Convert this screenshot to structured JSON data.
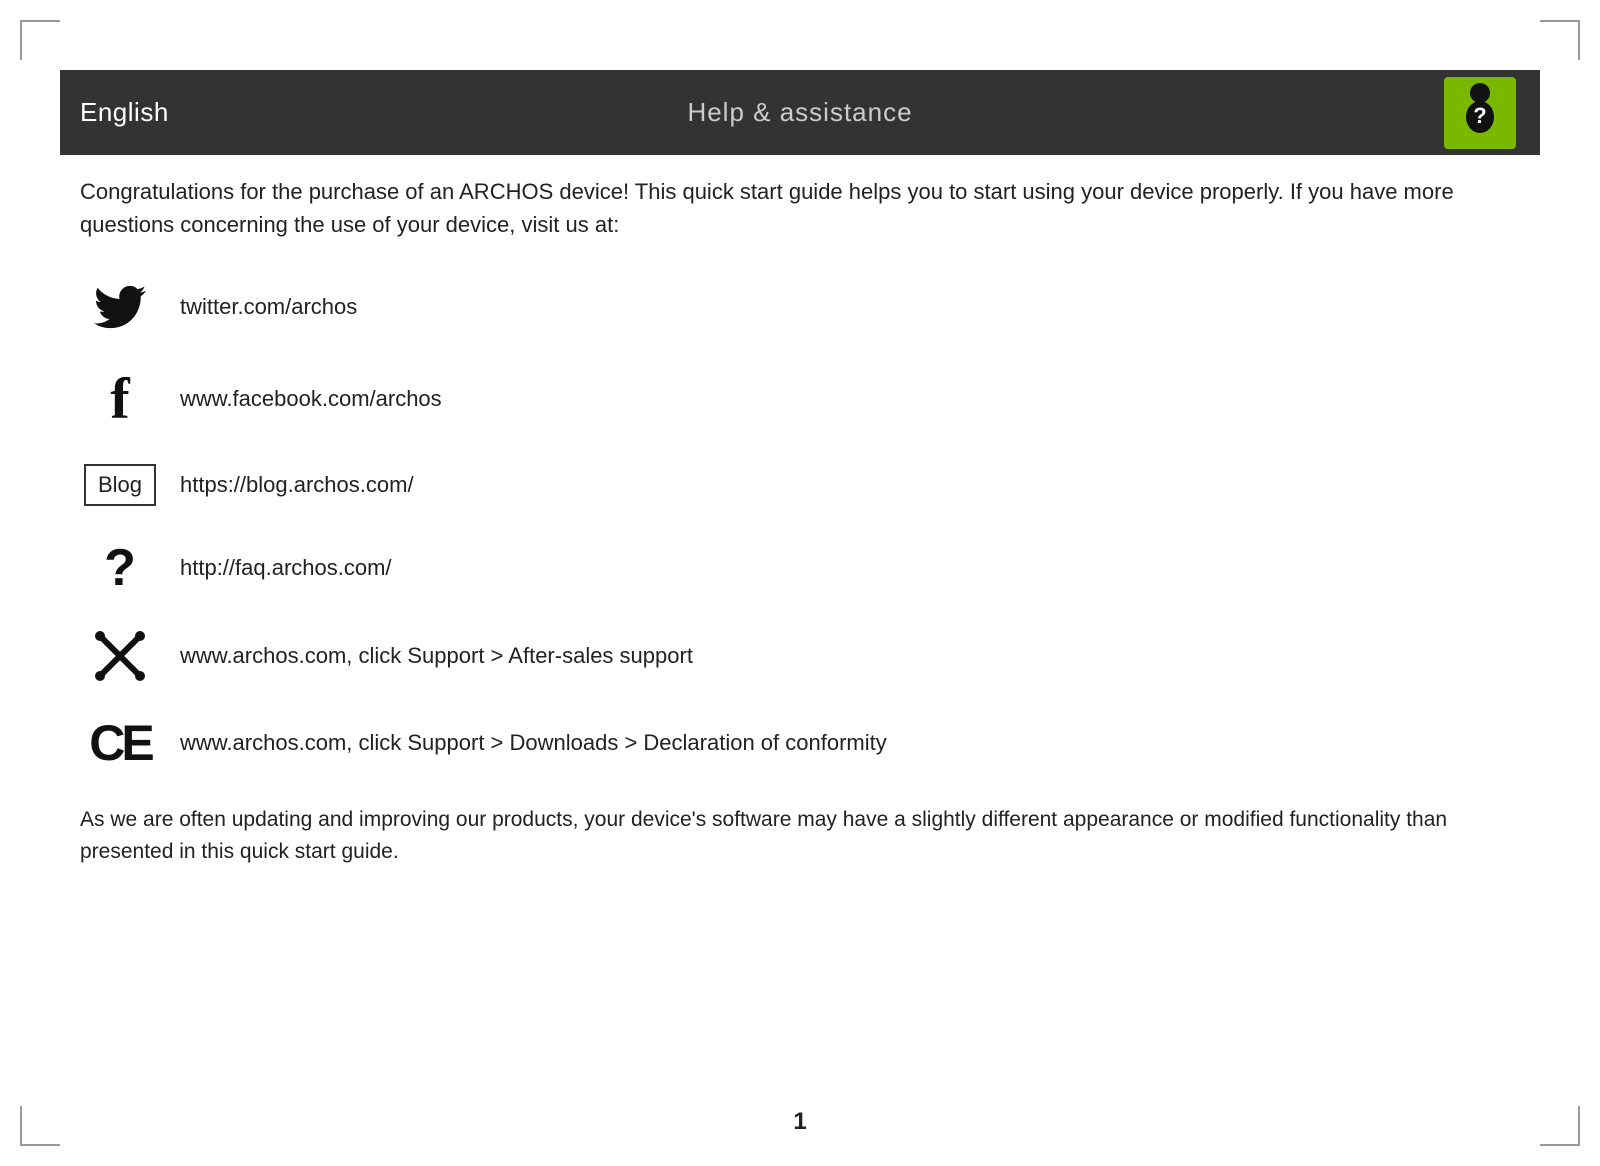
{
  "header": {
    "language": "English",
    "title": "Help & assistance"
  },
  "intro": "Congratulations for the purchase of an ARCHOS device! This quick start guide helps you to start using your device properly. If you have more questions concerning the use of your device, visit us at:",
  "links": [
    {
      "icon_type": "twitter",
      "icon_label": "twitter-icon",
      "url": "twitter.com/archos"
    },
    {
      "icon_type": "facebook",
      "icon_label": "facebook-icon",
      "url": "www.facebook.com/archos"
    },
    {
      "icon_type": "blog",
      "icon_label": "blog-icon",
      "url": "https://blog.archos.com/"
    },
    {
      "icon_type": "faq",
      "icon_label": "faq-icon",
      "url": "http://faq.archos.com/"
    },
    {
      "icon_type": "support",
      "icon_label": "support-icon",
      "url": "www.archos.com, click Support > After-sales support"
    },
    {
      "icon_type": "ce",
      "icon_label": "ce-icon",
      "url": "www.archos.com, click Support > Downloads > Declaration of conformity"
    }
  ],
  "footer": "As we are often updating and improving our products, your device's software may have a slightly different appearance or modified functionality than presented in this quick start guide.",
  "page_number": "1"
}
